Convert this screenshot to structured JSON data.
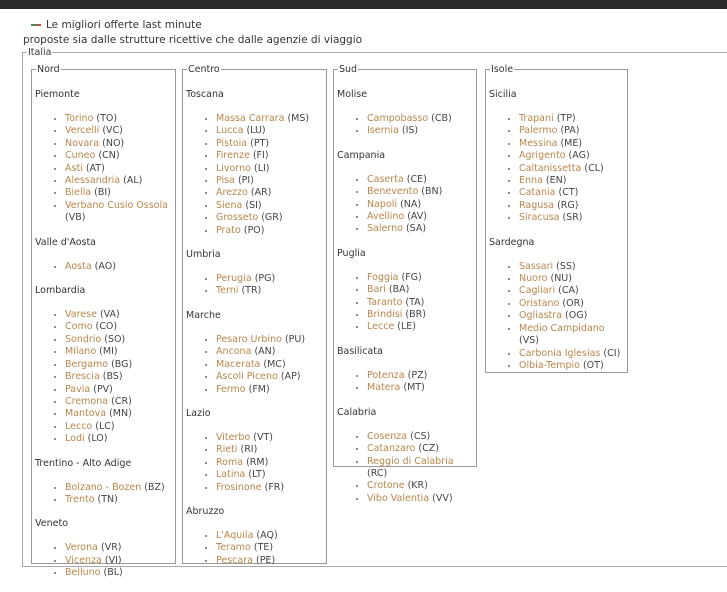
{
  "header": {
    "title": "Le migliori offerte last minute",
    "subtitle": "proposte sia dalle strutture ricettive che dalle agenzie di viaggio"
  },
  "country_legend": "Italia",
  "regions": [
    {
      "id": "nord",
      "name": "Nord",
      "areas": [
        {
          "name": "Piemonte",
          "provinces": [
            {
              "name": "Torino",
              "code": "(TO)"
            },
            {
              "name": "Vercelli",
              "code": "(VC)"
            },
            {
              "name": "Novara",
              "code": "(NO)"
            },
            {
              "name": "Cuneo",
              "code": "(CN)"
            },
            {
              "name": "Asti",
              "code": "(AT)"
            },
            {
              "name": "Alessandria",
              "code": "(AL)"
            },
            {
              "name": "Biella",
              "code": "(BI)"
            },
            {
              "name": "Verbano Cusio Ossola",
              "code": "(VB)"
            }
          ]
        },
        {
          "name": "Valle d'Aosta",
          "provinces": [
            {
              "name": "Aosta",
              "code": "(AO)"
            }
          ]
        },
        {
          "name": "Lombardia",
          "provinces": [
            {
              "name": "Varese",
              "code": "(VA)"
            },
            {
              "name": "Como",
              "code": "(CO)"
            },
            {
              "name": "Sondrio",
              "code": "(SO)"
            },
            {
              "name": "Milano",
              "code": "(MI)"
            },
            {
              "name": "Bergamo",
              "code": "(BG)"
            },
            {
              "name": "Brescia",
              "code": "(BS)"
            },
            {
              "name": "Pavia",
              "code": "(PV)"
            },
            {
              "name": "Cremona",
              "code": "(CR)"
            },
            {
              "name": "Mantova",
              "code": "(MN)"
            },
            {
              "name": "Lecco",
              "code": "(LC)"
            },
            {
              "name": "Lodi",
              "code": "(LO)"
            }
          ]
        },
        {
          "name": "Trentino - Alto Adige",
          "provinces": [
            {
              "name": "Bolzano - Bozen",
              "code": "(BZ)"
            },
            {
              "name": "Trento",
              "code": "(TN)"
            }
          ]
        },
        {
          "name": "Veneto",
          "provinces": [
            {
              "name": "Verona",
              "code": "(VR)"
            },
            {
              "name": "Vicenza",
              "code": "(VI)"
            },
            {
              "name": "Belluno",
              "code": "(BL)"
            }
          ]
        }
      ]
    },
    {
      "id": "centro",
      "name": "Centro",
      "areas": [
        {
          "name": "Toscana",
          "provinces": [
            {
              "name": "Massa Carrara",
              "code": "(MS)"
            },
            {
              "name": "Lucca",
              "code": "(LU)"
            },
            {
              "name": "Pistoia",
              "code": "(PT)"
            },
            {
              "name": "Firenze",
              "code": "(FI)"
            },
            {
              "name": "Livorno",
              "code": "(LI)"
            },
            {
              "name": "Pisa",
              "code": "(PI)"
            },
            {
              "name": "Arezzo",
              "code": "(AR)"
            },
            {
              "name": "Siena",
              "code": "(SI)"
            },
            {
              "name": "Grosseto",
              "code": "(GR)"
            },
            {
              "name": "Prato",
              "code": "(PO)"
            }
          ]
        },
        {
          "name": "Umbria",
          "provinces": [
            {
              "name": "Perugia",
              "code": "(PG)"
            },
            {
              "name": "Terni",
              "code": "(TR)"
            }
          ]
        },
        {
          "name": "Marche",
          "provinces": [
            {
              "name": "Pesaro Urbino",
              "code": "(PU)"
            },
            {
              "name": "Ancona",
              "code": "(AN)"
            },
            {
              "name": "Macerata",
              "code": "(MC)"
            },
            {
              "name": "Ascoli Piceno",
              "code": "(AP)"
            },
            {
              "name": "Fermo",
              "code": "(FM)"
            }
          ]
        },
        {
          "name": "Lazio",
          "provinces": [
            {
              "name": "Viterbo",
              "code": "(VT)"
            },
            {
              "name": "Rieti",
              "code": "(RI)"
            },
            {
              "name": "Roma",
              "code": "(RM)"
            },
            {
              "name": "Latina",
              "code": "(LT)"
            },
            {
              "name": "Frosinone",
              "code": "(FR)"
            }
          ]
        },
        {
          "name": "Abruzzo",
          "provinces": [
            {
              "name": "L'Aquila",
              "code": "(AQ)"
            },
            {
              "name": "Teramo",
              "code": "(TE)"
            },
            {
              "name": "Pescara",
              "code": "(PE)"
            }
          ]
        }
      ]
    },
    {
      "id": "sud",
      "name": "Sud",
      "areas": [
        {
          "name": "Molise",
          "provinces": [
            {
              "name": "Campobasso",
              "code": "(CB)"
            },
            {
              "name": "Isernia",
              "code": "(IS)"
            }
          ]
        },
        {
          "name": "Campania",
          "provinces": [
            {
              "name": "Caserta",
              "code": "(CE)"
            },
            {
              "name": "Benevento",
              "code": "(BN)"
            },
            {
              "name": "Napoli",
              "code": "(NA)"
            },
            {
              "name": "Avellino",
              "code": "(AV)"
            },
            {
              "name": "Salerno",
              "code": "(SA)"
            }
          ]
        },
        {
          "name": "Puglia",
          "provinces": [
            {
              "name": "Foggia",
              "code": "(FG)"
            },
            {
              "name": "Bari",
              "code": "(BA)"
            },
            {
              "name": "Taranto",
              "code": "(TA)"
            },
            {
              "name": "Brindisi",
              "code": "(BR)"
            },
            {
              "name": "Lecce",
              "code": "(LE)"
            }
          ]
        },
        {
          "name": "Basilicata",
          "provinces": [
            {
              "name": "Potenza",
              "code": "(PZ)"
            },
            {
              "name": "Matera",
              "code": "(MT)"
            }
          ]
        },
        {
          "name": "Calabria",
          "provinces": [
            {
              "name": "Cosenza",
              "code": "(CS)"
            },
            {
              "name": "Catanzaro",
              "code": "(CZ)"
            },
            {
              "name": "Reggio di Calabria",
              "code": "(RC)"
            },
            {
              "name": "Crotone",
              "code": "(KR)"
            },
            {
              "name": "Vibo Valentia",
              "code": "(VV)"
            }
          ]
        }
      ]
    },
    {
      "id": "isole",
      "name": "Isole",
      "areas": [
        {
          "name": "Sicilia",
          "provinces": [
            {
              "name": "Trapani",
              "code": "(TP)"
            },
            {
              "name": "Palermo",
              "code": "(PA)"
            },
            {
              "name": "Messina",
              "code": "(ME)"
            },
            {
              "name": "Agrigento",
              "code": "(AG)"
            },
            {
              "name": "Caltanissetta",
              "code": "(CL)"
            },
            {
              "name": "Enna",
              "code": "(EN)"
            },
            {
              "name": "Catania",
              "code": "(CT)"
            },
            {
              "name": "Ragusa",
              "code": "(RG)"
            },
            {
              "name": "Siracusa",
              "code": "(SR)"
            }
          ]
        },
        {
          "name": "Sardegna",
          "provinces": [
            {
              "name": "Sassari",
              "code": "(SS)"
            },
            {
              "name": "Nuoro",
              "code": "(NU)"
            },
            {
              "name": "Cagliari",
              "code": "(CA)"
            },
            {
              "name": "Oristano",
              "code": "(OR)"
            },
            {
              "name": "Ogliastra",
              "code": "(OG)"
            },
            {
              "name": "Medio Campidano",
              "code": "(VS)"
            },
            {
              "name": "Carbonia Iglesias",
              "code": "(CI)"
            },
            {
              "name": "Olbia-Tempio",
              "code": "(OT)"
            }
          ]
        }
      ]
    }
  ],
  "colors": {
    "link": "#b8864b",
    "text": "#333333",
    "topbar": "#2b2b2b",
    "border": "#999999"
  }
}
